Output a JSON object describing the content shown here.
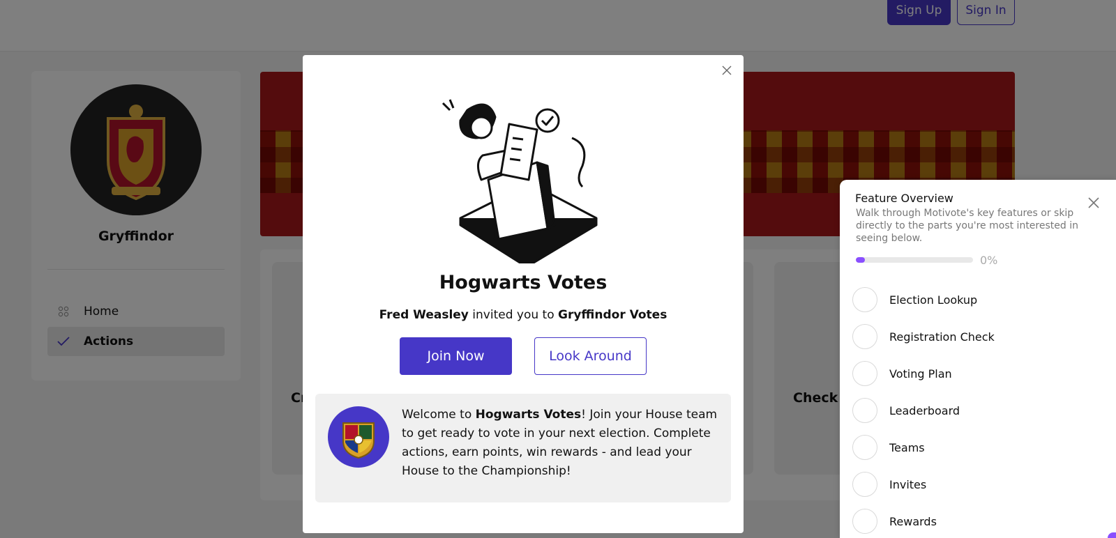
{
  "header": {
    "sign_up_label": "Sign Up",
    "sign_in_label": "Sign In"
  },
  "sidebar": {
    "house_name": "Gryffindor",
    "items": [
      {
        "label": "Home",
        "icon": "grid-icon"
      },
      {
        "label": "Actions",
        "icon": "check-icon"
      }
    ]
  },
  "action_cards": {
    "left_title_partial": "Cr",
    "right_title_partial": "Check R"
  },
  "modal": {
    "title": "Hogwarts Votes",
    "inviter": "Fred Weasley",
    "invite_text": "invited you to",
    "team": "Gryffindor Votes",
    "join_label": "Join Now",
    "look_label": "Look Around",
    "welcome_prefix": "Welcome to ",
    "welcome_bold": "Hogwarts Votes",
    "welcome_suffix": "! Join your House team to get ready to vote in your next election. Complete actions, earn points, win rewards - and lead your House to the Championship!"
  },
  "feature_overview": {
    "title": "Feature Overview",
    "description": "Walk through Motivote's key features or skip directly to the parts you're most interested in seeing below.",
    "progress_percent": 0,
    "progress_label": "0%",
    "items": [
      "Election Lookup",
      "Registration Check",
      "Voting Plan",
      "Leaderboard",
      "Teams",
      "Invites",
      "Rewards"
    ]
  },
  "colors": {
    "accent": "#4637c7",
    "progress": "#8a4fff",
    "banner_red": "#a8191b",
    "banner_gold": "#d8b24a"
  }
}
